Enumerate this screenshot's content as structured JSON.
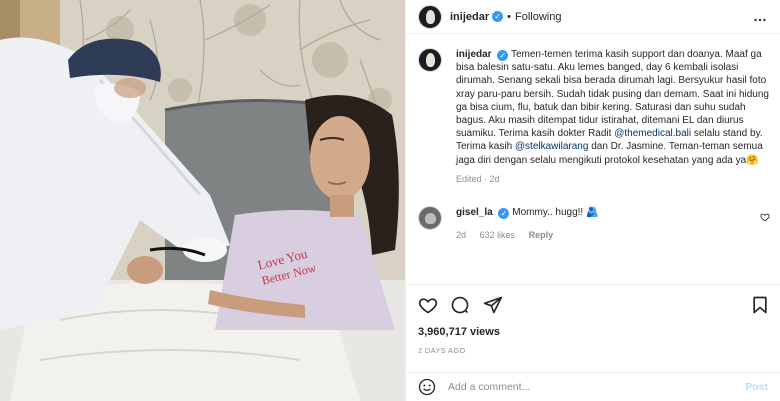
{
  "header": {
    "username": "inijedar",
    "verified_glyph": "✓",
    "separator": "•",
    "follow_status": "Following",
    "more_icon": "…"
  },
  "caption": {
    "username": "inijedar",
    "text_parts": {
      "p1": "Temen-temen terima kasih support dan doanya. Maaf ga bisa balesin satu-satu. Aku lemes banged, day 6 kembali isolasi dirumah. Senang sekali bisa berada dirumah lagi. Bersyukur hasil foto xray paru-paru bersih. Sudah tidak pusing dan demam. Saat ini hidung ga bisa cium, flu, batuk dan bibir kering. Saturasi dan suhu sudah bagus. Aku masih ditempat tidur istirahat, ditemani EL dan diurus suamiku. Terima kasih dokter Radit ",
      "mention1": "@themedical.bali",
      "p2": " selalu stand by. Terima kasih ",
      "mention2": "@stelkawilarang",
      "p3": " dan Dr. Jasmine. Teman-teman semua jaga diri dengan selalu mengikuti protokol kesehatan yang ada ya",
      "emoji": "🤗"
    },
    "meta": "Edited · 2d"
  },
  "comment": {
    "username": "gisel_la",
    "text": "Mommy.. hugg!! 🫂",
    "time": "2d",
    "likes": "632 likes",
    "reply": "Reply"
  },
  "views": "3,960,717 views",
  "time_ago": "2 DAYS AGO",
  "add_comment": {
    "placeholder": "Add a comment...",
    "post_label": "Post",
    "emoji_icon": "smiley-icon"
  },
  "colors": {
    "verified": "#3897f0",
    "mention": "#00376b",
    "muted": "#8e8e8e",
    "post_disabled": "#b2dffc"
  }
}
